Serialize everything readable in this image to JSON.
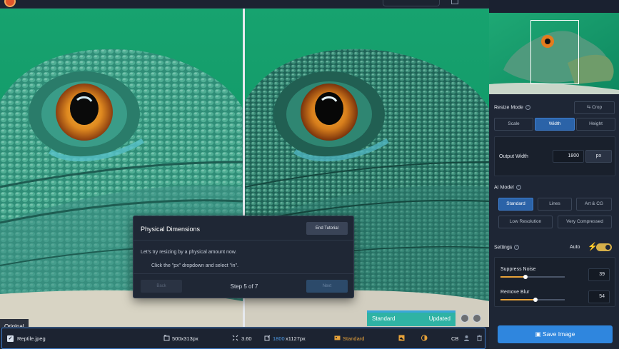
{
  "topbar": {
    "app_logo": "app-logo"
  },
  "comparison": {
    "left_label": "Original",
    "right_model": "Standard",
    "right_status": "Updated"
  },
  "tutorial": {
    "title": "Physical Dimensions",
    "end_label": "End Tutorial",
    "line1": "Let's try resizing by a physical amount now.",
    "line2": "Click the \"px\" dropdown and select \"in\".",
    "back_label": "Back",
    "step_text": "Step 5 of 7",
    "next_label": "Next"
  },
  "file": {
    "name": "Reptile.jpeg",
    "original_size": "500x313px",
    "scale": "3.60",
    "output_width": "1800",
    "output_size_rest": "x1127px",
    "model": "Standard",
    "format": "CB"
  },
  "sidebar": {
    "resize_mode_label": "Resize Mode",
    "crop_label": "Crop",
    "modes": [
      "Scale",
      "Width",
      "Height"
    ],
    "active_mode": "Width",
    "output_width_label": "Output Width",
    "output_width_value": "1800",
    "unit": "px",
    "ai_model_label": "AI Model",
    "models": [
      "Standard",
      "Lines",
      "Art & CG",
      "Low Resolution",
      "Very Compressed"
    ],
    "active_model": "Standard",
    "settings_label": "Settings",
    "auto_label": "Auto",
    "suppress_noise_label": "Suppress Noise",
    "suppress_noise_value": "39",
    "suppress_noise_level": 0.39,
    "remove_blur_label": "Remove Blur",
    "remove_blur_value": "54",
    "remove_blur_level": 0.54,
    "save_label": "Save Image"
  },
  "colors": {
    "accent": "#2f86de",
    "active": "#2b63a8",
    "warning": "#e8a33a",
    "teal": "#2fb3a4"
  }
}
